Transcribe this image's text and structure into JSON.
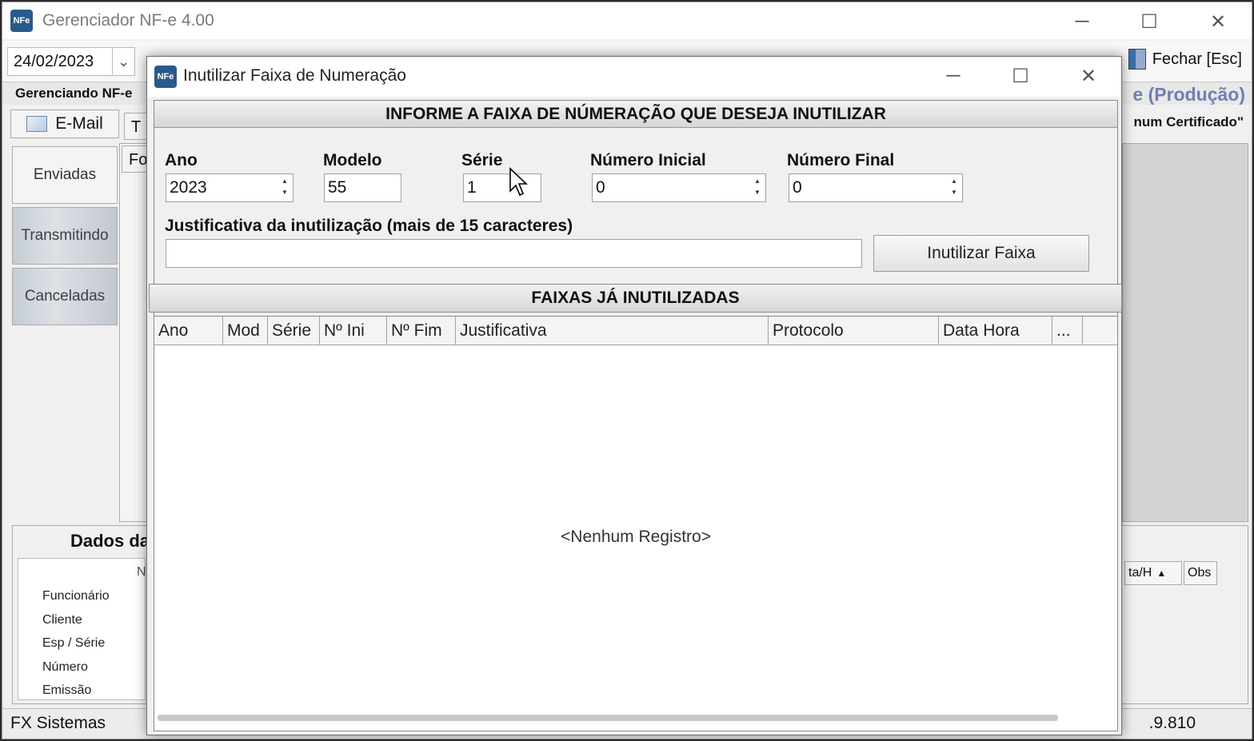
{
  "main_window": {
    "title": "Gerenciador NF-e 4.00",
    "app_icon_text": "NFe",
    "toolbar": {
      "date_from": "24/02/2023",
      "close_label": "Fechar [Esc]"
    },
    "strip_label": "Gerenciando NF-e",
    "environment_label": "e (Produção)",
    "email_button": "E-Mail",
    "tab_fragment_1": "T",
    "tab_fragment_2": "Fo",
    "certificate_label": "num Certificado\"",
    "sidebar": [
      {
        "label": "Enviadas"
      },
      {
        "label": "Transmitindo"
      },
      {
        "label": "Canceladas"
      }
    ],
    "dados": {
      "title": "Dados da",
      "col_fragment": "N",
      "rows": [
        "Funcionário",
        "Cliente",
        "Esp / Série",
        "Número",
        "Emissão"
      ],
      "col_data_hora": "ta/H",
      "col_obs": "Obs"
    },
    "footer_left": "FX Sistemas",
    "footer_right": ".9.810"
  },
  "dialog": {
    "title": "Inutilizar Faixa de Numeração",
    "app_icon_text": "NFe",
    "section1_header": "INFORME A FAIXA DE NÚMERAÇÃO QUE DESEJA INUTILIZAR",
    "fields": {
      "ano": {
        "label": "Ano",
        "value": "2023"
      },
      "modelo": {
        "label": "Modelo",
        "value": "55"
      },
      "serie": {
        "label": "Série",
        "value": "1"
      },
      "numero_inicial": {
        "label": "Número Inicial",
        "value": "0"
      },
      "numero_final": {
        "label": "Número Final",
        "value": "0"
      }
    },
    "justificativa_label": "Justificativa da inutilização (mais de 15 caracteres)",
    "justificativa_value": "",
    "inutilizar_button": "Inutilizar Faixa",
    "section2_header": "FAIXAS JÁ INUTILIZADAS",
    "grid_columns": [
      "Ano",
      "Mod",
      "Série",
      "Nº Ini",
      "Nº Fim",
      "Justificativa",
      "Protocolo",
      "Data Hora",
      "..."
    ],
    "grid_empty_text": "<Nenhum Registro>"
  },
  "colors": {
    "environment_label": "#6f7fb5",
    "app_icon": "#2a5a8c"
  }
}
